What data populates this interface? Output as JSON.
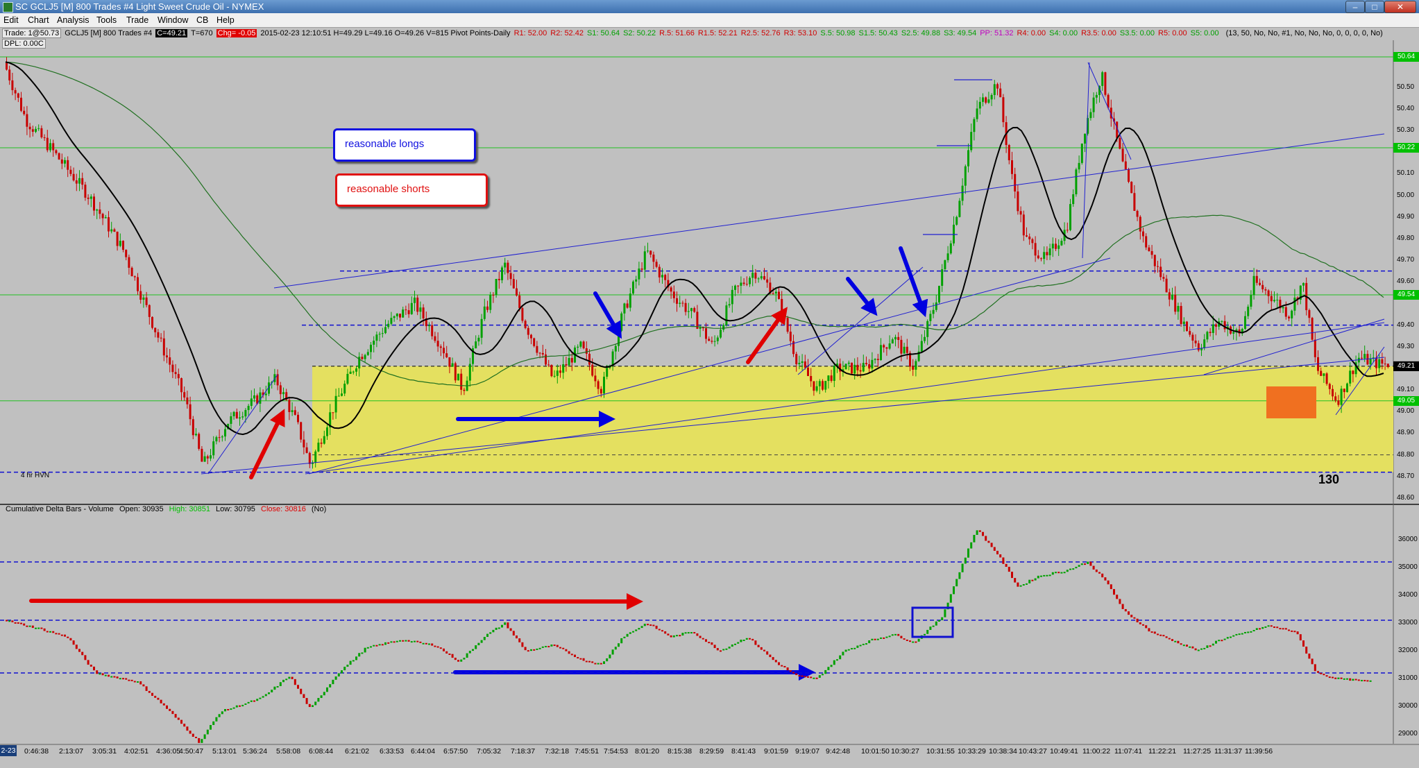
{
  "title_bar": {
    "title": "SC GCLJ5 [M]  800 Trades  #4  Light Sweet Crude Oil - NYMEX",
    "buttons": [
      "–",
      "□",
      "✕"
    ]
  },
  "menu": [
    "Edit",
    "Chart",
    "Analysis",
    "Tools",
    "Trade",
    "Window",
    "CB",
    "Help"
  ],
  "status": {
    "trade": "Trade: 1@50.73",
    "symbol": "GCLJ5 [M]  800 Trades  #4",
    "close_tag": "C=49.21",
    "t": "T=670",
    "chg": "Chg= -0.05",
    "rest": "2015-02-23 12:10:51 H=49.29 L=49.16 O=49.26 V=815 Pivot Points-Daily",
    "pivots": [
      {
        "t": "R1: 52.00",
        "c": "#d00000"
      },
      {
        "t": "R2: 52.42",
        "c": "#d00000"
      },
      {
        "t": "S1: 50.64",
        "c": "#00a000"
      },
      {
        "t": "S2: 50.22",
        "c": "#00a000"
      },
      {
        "t": "R.5: 51.66",
        "c": "#d00000"
      },
      {
        "t": "R1.5: 52.21",
        "c": "#d00000"
      },
      {
        "t": "R2.5: 52.76",
        "c": "#d00000"
      },
      {
        "t": "R3: 53.10",
        "c": "#d00000"
      },
      {
        "t": "S.5: 50.98",
        "c": "#00a000"
      },
      {
        "t": "S1.5: 50.43",
        "c": "#00a000"
      },
      {
        "t": "S2.5: 49.88",
        "c": "#00a000"
      },
      {
        "t": "S3: 49.54",
        "c": "#00a000"
      },
      {
        "t": "PP: 51.32",
        "c": "#c000c0"
      },
      {
        "t": "R4: 0.00",
        "c": "#d00000"
      },
      {
        "t": "S4: 0.00",
        "c": "#00a000"
      },
      {
        "t": "R3.5: 0.00",
        "c": "#d00000"
      },
      {
        "t": "S3.5: 0.00",
        "c": "#00a000"
      },
      {
        "t": "R5: 0.00",
        "c": "#d00000"
      },
      {
        "t": "S5: 0.00",
        "c": "#00a000"
      }
    ],
    "params": "(13, 50, No, No, #1, No, No, No, 0, 0, 0, 0, No)",
    "dpl": "DPL: 0.00C"
  },
  "legend": {
    "longs": "reasonable longs",
    "shorts": "reasonable shorts"
  },
  "labels": {
    "hvn": "4 hr HVN",
    "count": "130",
    "date_marker": "2-23"
  },
  "price_axis": [
    "50.64",
    "50.50",
    "50.40",
    "50.30",
    "50.22",
    "50.10",
    "50.00",
    "49.90",
    "49.80",
    "49.70",
    "49.60",
    "49.54",
    "49.40",
    "49.30",
    "49.21",
    "49.10",
    "49.05",
    "49.00",
    "48.90",
    "48.80",
    "48.70",
    "48.60"
  ],
  "delta_panel": {
    "name": "Cumulative Delta Bars - Volume",
    "open": "Open: 30935",
    "high": "High: 30851",
    "low": "Low: 30795",
    "close": "Close: 30816",
    "flag": "(No)",
    "axis": [
      "36000",
      "35000",
      "34000",
      "33000",
      "32000",
      "31000",
      "30000",
      "29000"
    ]
  },
  "time_axis": [
    "0:46:38",
    "2:13:07",
    "3:05:31",
    "4:02:51",
    "4:36:05",
    "4:50:47",
    "5:13:01",
    "5:36:24",
    "5:58:08",
    "6:08:44",
    "6:21:02",
    "6:33:53",
    "6:44:04",
    "6:57:50",
    "7:05:32",
    "7:18:37",
    "7:32:18",
    "7:45:51",
    "7:54:53",
    "8:01:20",
    "8:15:38",
    "8:29:59",
    "8:41:43",
    "9:01:59",
    "9:19:07",
    "9:42:48",
    "10:01:50",
    "10:30:27",
    "10:31:55",
    "10:33:29",
    "10:38:34",
    "10:43:27",
    "10:49:41",
    "11:00:22",
    "11:07:41",
    "11:22:21",
    "11:27:25",
    "11:31:37",
    "11:39:56"
  ],
  "colors": {
    "panel_bg": "#c0c0c0",
    "zone": "#e4e060",
    "up_bar": "#00a000",
    "down_bar": "#c80000",
    "long_arrow": "#0000e0",
    "short_arrow": "#e00000",
    "ma_fast": "#000000",
    "ma_slow": "#207020",
    "orange_box": "#f07020"
  }
}
